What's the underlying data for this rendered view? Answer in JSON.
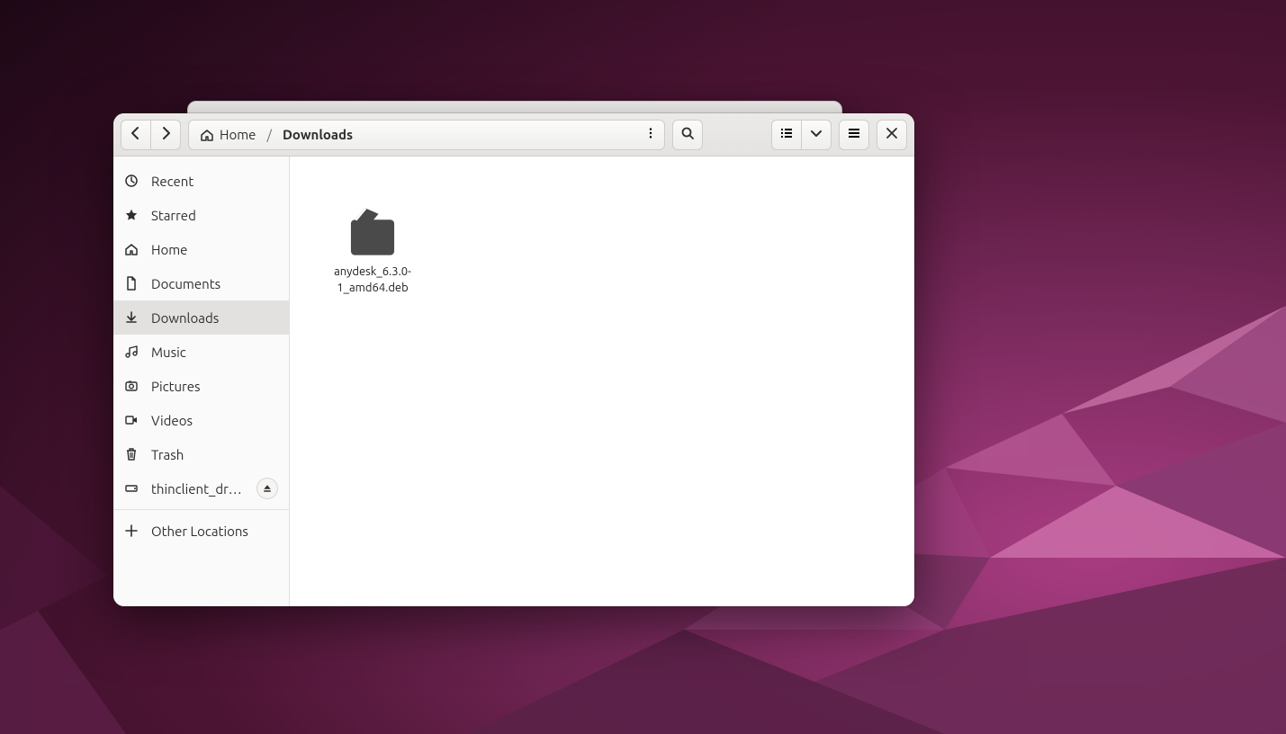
{
  "breadcrumb": {
    "home_label": "Home",
    "current_label": "Downloads"
  },
  "sidebar": {
    "items": [
      {
        "label": "Recent",
        "icon": "clock-icon"
      },
      {
        "label": "Starred",
        "icon": "star-icon"
      },
      {
        "label": "Home",
        "icon": "home-icon"
      },
      {
        "label": "Documents",
        "icon": "document-icon"
      },
      {
        "label": "Downloads",
        "icon": "download-icon",
        "active": true
      },
      {
        "label": "Music",
        "icon": "music-icon"
      },
      {
        "label": "Pictures",
        "icon": "camera-icon"
      },
      {
        "label": "Videos",
        "icon": "video-icon"
      },
      {
        "label": "Trash",
        "icon": "trash-icon"
      }
    ],
    "mounts": [
      {
        "label": "thinclient_drives",
        "icon": "drive-icon",
        "ejectable": true
      }
    ],
    "other_label": "Other Locations"
  },
  "files": [
    {
      "name": "anydesk_6.3.0-1_amd64.deb",
      "kind": "package"
    }
  ]
}
